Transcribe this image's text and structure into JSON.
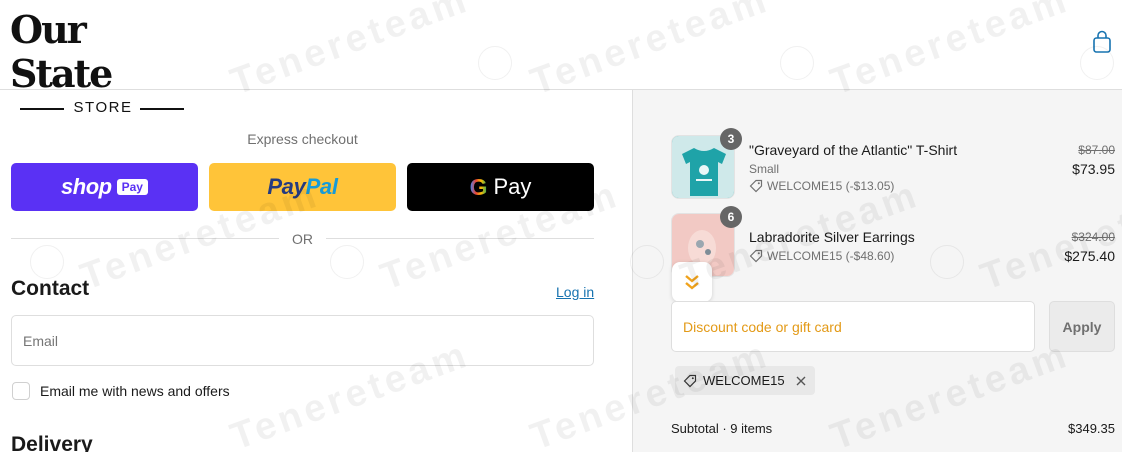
{
  "header": {
    "logo_main": "Our State",
    "logo_sub": "STORE",
    "cart_icon": "shopping-bag-icon"
  },
  "express": {
    "label": "Express checkout",
    "shop_word": "shop",
    "shop_badge": "Pay",
    "paypal_part1": "Pay",
    "paypal_part2": "Pal",
    "gpay_g": "G",
    "gpay_word": "Pay",
    "or_text": "OR"
  },
  "contact": {
    "heading": "Contact",
    "login_link": "Log in",
    "email_placeholder": "Email",
    "newsletter_label": "Email me with news and offers"
  },
  "delivery": {
    "heading": "Delivery"
  },
  "cart": {
    "items": [
      {
        "name": "\"Graveyard of the Atlantic\" T-Shirt",
        "variant": "Small",
        "quantity": "3",
        "discount": "WELCOME15 (-$13.05)",
        "original_price": "$87.00",
        "price": "$73.95"
      },
      {
        "name": "Labradorite Silver Earrings",
        "variant": "",
        "quantity": "6",
        "discount": "WELCOME15 (-$48.60)",
        "original_price": "$324.00",
        "price": "$275.40"
      }
    ],
    "discount_placeholder": "Discount code or gift card",
    "apply_label": "Apply",
    "applied_code": "WELCOME15",
    "subtotal_label": "Subtotal · 9 items",
    "subtotal_value": "$349.35"
  },
  "watermark": "Tenereteam",
  "colors": {
    "shop_pay": "#5a31f4",
    "paypal": "#ffc439",
    "gpay": "#000000",
    "link": "#1773b0",
    "summary_bg": "#f5f5f5",
    "discount_accent": "#e39a17"
  }
}
